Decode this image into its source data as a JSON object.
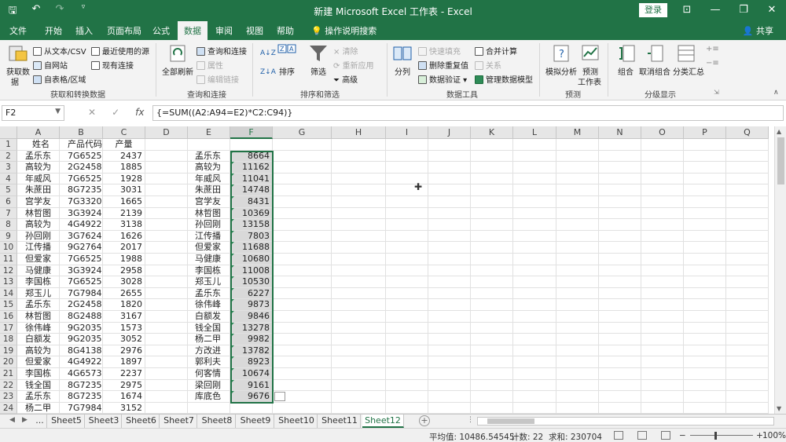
{
  "window": {
    "title": "新建 Microsoft Excel 工作表 - Excel",
    "login": "登录",
    "share": "共享",
    "tell_me": "操作说明搜索"
  },
  "menu_tabs": [
    "文件",
    "开始",
    "插入",
    "页面布局",
    "公式",
    "数据",
    "审阅",
    "视图",
    "帮助"
  ],
  "active_tab": "数据",
  "ribbon": {
    "groups": {
      "get_transform": "获取和转换数据",
      "queries": "查询和连接",
      "sort_filter": "排序和筛选",
      "data_tools": "数据工具",
      "forecast": "预测",
      "outline": "分级显示"
    },
    "get_data": [
      "获取数",
      "据"
    ],
    "from_text": "从文本/CSV",
    "recent_sources": "最近使用的源",
    "from_web": "自网站",
    "existing_conn": "现有连接",
    "from_table": "自表格/区域",
    "refresh_all": "全部刷新",
    "queries_conn": "查询和连接",
    "properties": "属性",
    "edit_links": "编辑链接",
    "sort_az": "A↓Z",
    "sort": "排序",
    "filter": "筛选",
    "clear": "清除",
    "reapply": "重新应用",
    "advanced": "高级",
    "split": "分列",
    "flash_fill": "快速填充",
    "remove_dup": "删除重复值",
    "validation": "数据验证",
    "consolidate": "合并计算",
    "relations": "关系",
    "data_model": "管理数据模型",
    "what_if": "模拟分析",
    "forecast_sheet": [
      "预测",
      "工作表"
    ],
    "group": "组合",
    "ungroup": "取消组合",
    "subtotal": "分类汇总"
  },
  "formula_bar": {
    "name_box": "F2",
    "fx": "fx",
    "formula": "{=SUM((A2:A94=E2)*C2:C94)}"
  },
  "columns": [
    "A",
    "B",
    "C",
    "D",
    "E",
    "F",
    "G",
    "H",
    "I",
    "J",
    "K",
    "L",
    "M",
    "N",
    "O",
    "P",
    "Q"
  ],
  "rows": [
    {
      "n": "1",
      "a": "姓名",
      "b": "产品代码",
      "c": "产量",
      "e": "",
      "f": ""
    },
    {
      "n": "2",
      "a": "孟乐东",
      "b": "7G65253",
      "c": "2437",
      "e": "孟乐东",
      "f": "8664"
    },
    {
      "n": "3",
      "a": "高较为",
      "b": "2G24582",
      "c": "1885",
      "e": "高较为",
      "f": "11162"
    },
    {
      "n": "4",
      "a": "年威风",
      "b": "7G65253",
      "c": "1928",
      "e": "年威风",
      "f": "11041"
    },
    {
      "n": "5",
      "a": "朱蔗田",
      "b": "8G72351",
      "c": "3031",
      "e": "朱蔗田",
      "f": "14748"
    },
    {
      "n": "6",
      "a": "宫学友",
      "b": "7G33203",
      "c": "1665",
      "e": "宫学友",
      "f": "8431"
    },
    {
      "n": "7",
      "a": "林哲图",
      "b": "3G39243",
      "c": "2139",
      "e": "林哲图",
      "f": "10369"
    },
    {
      "n": "8",
      "a": "高较为",
      "b": "4G49224",
      "c": "3138",
      "e": "孙回刚",
      "f": "13158"
    },
    {
      "n": "9",
      "a": "孙回刚",
      "b": "3G76248",
      "c": "1626",
      "e": "江传播",
      "f": "7803"
    },
    {
      "n": "10",
      "a": "江传播",
      "b": "9G27648",
      "c": "2017",
      "e": "但爱家",
      "f": "11688"
    },
    {
      "n": "11",
      "a": "但爱家",
      "b": "7G65253",
      "c": "1988",
      "e": "马健康",
      "f": "10680"
    },
    {
      "n": "12",
      "a": "马健康",
      "b": "3G39243",
      "c": "2958",
      "e": "李国栋",
      "f": "11008"
    },
    {
      "n": "13",
      "a": "李国栋",
      "b": "7G65253",
      "c": "3028",
      "e": "郑玉儿",
      "f": "10530"
    },
    {
      "n": "14",
      "a": "郑玉儿",
      "b": "7G79845",
      "c": "2655",
      "e": "孟乐东",
      "f": "6227"
    },
    {
      "n": "15",
      "a": "孟乐东",
      "b": "2G24582",
      "c": "1820",
      "e": "徐伟峰",
      "f": "9873"
    },
    {
      "n": "16",
      "a": "林哲图",
      "b": "8G24885",
      "c": "3167",
      "e": "白额发",
      "f": "9846"
    },
    {
      "n": "17",
      "a": "徐伟峰",
      "b": "9G20352",
      "c": "1573",
      "e": "钱全国",
      "f": "13278"
    },
    {
      "n": "18",
      "a": "白额发",
      "b": "9G20352",
      "c": "3052",
      "e": "杨二甲",
      "f": "9982"
    },
    {
      "n": "19",
      "a": "高较为",
      "b": "8G41389",
      "c": "2976",
      "e": "方改进",
      "f": "13782"
    },
    {
      "n": "20",
      "a": "但爱家",
      "b": "4G49224",
      "c": "1897",
      "e": "郭利夫",
      "f": "8923"
    },
    {
      "n": "21",
      "a": "李国栋",
      "b": "4G65736",
      "c": "2237",
      "e": "何客情",
      "f": "10674"
    },
    {
      "n": "22",
      "a": "钱全国",
      "b": "8G72351",
      "c": "2975",
      "e": "梁回刚",
      "f": "9161"
    },
    {
      "n": "23",
      "a": "孟乐东",
      "b": "8G72351",
      "c": "1674",
      "e": "库底色",
      "f": "9676"
    },
    {
      "n": "24",
      "a": "杨二甲",
      "b": "7G79845",
      "c": "3152",
      "e": "",
      "f": ""
    }
  ],
  "sheet_tabs": [
    "...",
    "Sheet5",
    "Sheet3",
    "Sheet6",
    "Sheet7",
    "Sheet8",
    "Sheet9",
    "Sheet10",
    "Sheet11",
    "Sheet12"
  ],
  "active_sheet": "Sheet12",
  "status": {
    "average": "平均值: 10486.54545",
    "count": "计数: 22",
    "sum": "求和: 230704",
    "zoom": "100%"
  },
  "colors": {
    "excel_green": "#217346",
    "ribbon_bg": "#f3f3f3",
    "header_bg": "#e6e6e6"
  }
}
